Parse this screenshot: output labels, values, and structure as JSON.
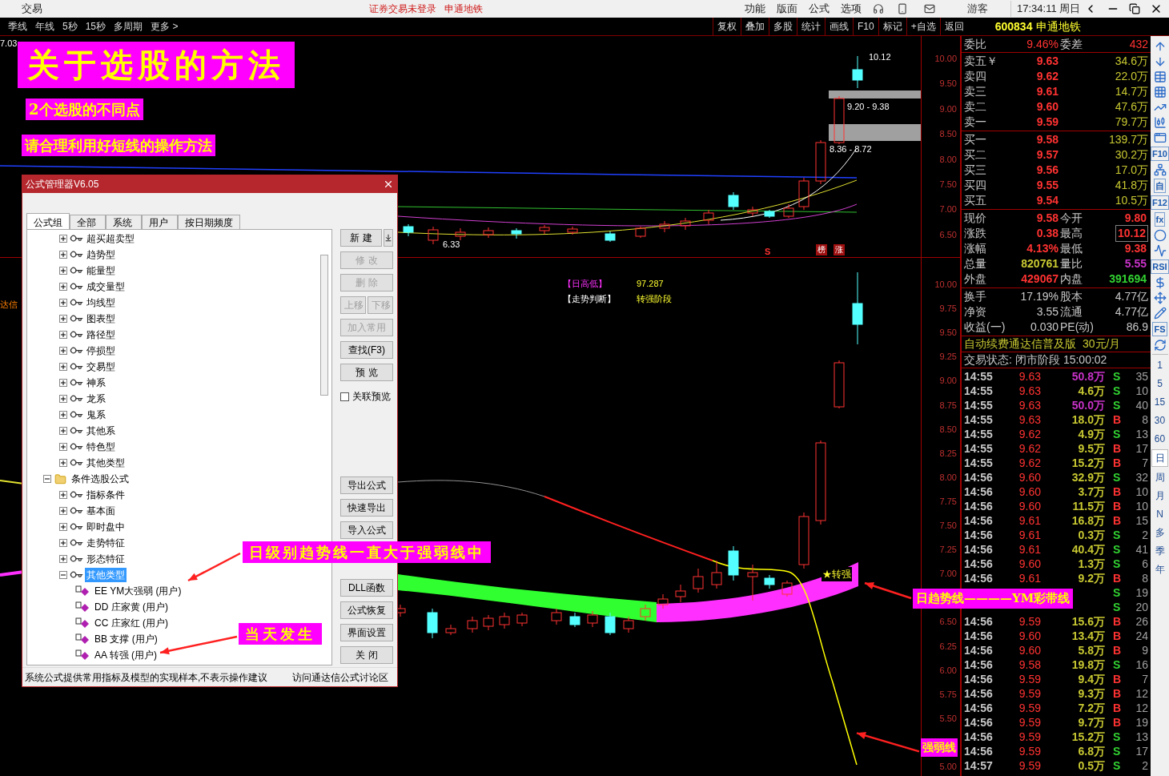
{
  "titlebar": {
    "app_label": "交易",
    "login_status": "证券交易未登录",
    "stock_name": "申通地铁",
    "menu": [
      "功能",
      "版面",
      "公式",
      "选项"
    ],
    "user": "游客",
    "clock": "17:34:11 周日"
  },
  "period_bar": [
    "季线",
    "年线",
    "5秒",
    "15秒",
    "多周期",
    "更多 >"
  ],
  "chart_toolbar": [
    "复权",
    "叠加",
    "多股",
    "统计",
    "画线",
    "F10",
    "标记",
    "+自选",
    "返回"
  ],
  "chart": {
    "corner_value": "7.03",
    "left_cut_text": "达信",
    "upper_axis": [
      "10.00",
      "9.50",
      "9.00",
      "8.50",
      "8.00",
      "7.50",
      "7.00",
      "6.50"
    ],
    "lower_axis": [
      "10.00",
      "9.75",
      "9.50",
      "9.25",
      "9.00",
      "8.75",
      "8.50",
      "8.25",
      "8.00",
      "7.75",
      "7.50",
      "7.25",
      "7.00",
      "6.50",
      "6.25",
      "6.00",
      "5.75",
      "5.50",
      "5.00"
    ],
    "high_label": "10.12",
    "zone_upper": "9.20 - 9.38",
    "zone_lower": "8.36 - 8.72",
    "low_label": "6.33",
    "signal_s": "S",
    "badges": [
      "榜",
      "涨"
    ],
    "info": [
      {
        "label": "【日高低】",
        "value": "97.287",
        "kind": "magenta"
      },
      {
        "label": "【走势判断】",
        "value": "转强阶段",
        "kind": "white"
      }
    ],
    "star_label": "★转强"
  },
  "annotations": {
    "title": "关于选股的方法",
    "subtitle": "2个选股的不同点",
    "hint": "请合理利用好短线的操作方法",
    "trend_note": "日级别趋势线一直大于强弱线中",
    "same_day": "当天发生",
    "band_note": "日趋势线————YM彩带线",
    "weak_line": "强弱线"
  },
  "dialog": {
    "title": "公式管理器V6.05",
    "tabs": [
      {
        "label": "公式组",
        "selected": true
      },
      {
        "label": "全部",
        "selected": false
      },
      {
        "label": "系统",
        "selected": false
      },
      {
        "label": "用户",
        "selected": false
      },
      {
        "label": "按日期频度",
        "selected": false
      }
    ],
    "tree": {
      "continued": [
        {
          "label": "超买超卖型",
          "kind": "group",
          "expanded": false,
          "selected": false
        },
        {
          "label": "趋势型",
          "kind": "group",
          "expanded": false,
          "selected": false
        },
        {
          "label": "能量型",
          "kind": "group",
          "expanded": false,
          "selected": false
        },
        {
          "label": "成交量型",
          "kind": "group",
          "expanded": false,
          "selected": false
        },
        {
          "label": "均线型",
          "kind": "group",
          "expanded": false,
          "selected": false
        },
        {
          "label": "图表型",
          "kind": "group",
          "expanded": false,
          "selected": false
        },
        {
          "label": "路径型",
          "kind": "group",
          "expanded": false,
          "selected": false
        },
        {
          "label": "停损型",
          "kind": "group",
          "expanded": false,
          "selected": false
        },
        {
          "label": "交易型",
          "kind": "group",
          "expanded": false,
          "selected": false
        },
        {
          "label": "神系",
          "kind": "group",
          "expanded": false,
          "selected": false
        },
        {
          "label": "龙系",
          "kind": "group",
          "expanded": false,
          "selected": false
        },
        {
          "label": "鬼系",
          "kind": "group",
          "expanded": false,
          "selected": false
        },
        {
          "label": "其他系",
          "kind": "group",
          "expanded": false,
          "selected": false
        },
        {
          "label": "特色型",
          "kind": "group",
          "expanded": false,
          "selected": false
        },
        {
          "label": "其他类型",
          "kind": "group",
          "expanded": false,
          "selected": false
        }
      ],
      "roots": [
        {
          "label": "条件选股公式",
          "kind": "folder",
          "expanded": true,
          "selected": false,
          "children": [
            {
              "label": "指标条件",
              "kind": "group",
              "expanded": false,
              "selected": false
            },
            {
              "label": "基本面",
              "kind": "group",
              "expanded": false,
              "selected": false
            },
            {
              "label": "即时盘中",
              "kind": "group",
              "expanded": false,
              "selected": false
            },
            {
              "label": "走势特征",
              "kind": "group",
              "expanded": false,
              "selected": false
            },
            {
              "label": "形态特征",
              "kind": "group",
              "expanded": false,
              "selected": false
            },
            {
              "label": "其他类型",
              "kind": "group",
              "expanded": true,
              "selected": true,
              "children": [
                {
                  "label": "EE YM大强弱 (用户)",
                  "kind": "formula",
                  "selected": false
                },
                {
                  "label": "DD 庄家黄 (用户)",
                  "kind": "formula",
                  "selected": false
                },
                {
                  "label": "CC 庄家红 (用户)",
                  "kind": "formula",
                  "selected": false
                },
                {
                  "label": "BB 支撑 (用户)",
                  "kind": "formula",
                  "selected": false
                },
                {
                  "label": "AA 转强 (用户)",
                  "kind": "formula",
                  "selected": false
                }
              ]
            }
          ]
        }
      ]
    },
    "buttons_top": [
      {
        "kind": "split",
        "label": "新 建",
        "disabled": false
      },
      {
        "kind": "button",
        "label": "修 改",
        "disabled": true
      },
      {
        "kind": "button",
        "label": "删 除",
        "disabled": true
      },
      {
        "kind": "pair",
        "items": [
          {
            "label": "上移",
            "disabled": true
          },
          {
            "label": "下移",
            "disabled": true
          }
        ]
      },
      {
        "kind": "button",
        "label": "加入常用",
        "disabled": true
      },
      {
        "kind": "button",
        "label": "查找(F3)",
        "disabled": false
      },
      {
        "kind": "button",
        "label": "预 览",
        "disabled": false
      },
      {
        "kind": "checkbox",
        "label": "关联预览",
        "checked": false
      }
    ],
    "buttons_bottom": [
      {
        "kind": "button",
        "label": "导出公式",
        "disabled": false
      },
      {
        "kind": "button",
        "label": "快速导出",
        "disabled": false
      },
      {
        "kind": "button",
        "label": "导入公式",
        "disabled": false
      },
      {
        "kind": "covered"
      },
      {
        "kind": "gap"
      },
      {
        "kind": "button",
        "label": "DLL函数",
        "disabled": false
      },
      {
        "kind": "button",
        "label": "公式恢复",
        "disabled": false
      },
      {
        "kind": "button",
        "label": "界面设置",
        "disabled": false
      },
      {
        "kind": "button",
        "label": "关 闭",
        "disabled": false
      }
    ],
    "status_text": "系统公式提供常用指标及模型的实现样本,不表示操作建议",
    "forum_link": "访问通达信公式讨论区"
  },
  "quote": {
    "code": "600834",
    "name": "申通地铁",
    "ratio": {
      "label": "委比",
      "value": "9.46%",
      "label2": "委差",
      "value2": "432"
    },
    "asks": [
      {
        "label": "卖五￥",
        "price": "9.63",
        "volume": "34.6万"
      },
      {
        "label": "卖四",
        "price": "9.62",
        "volume": "22.0万"
      },
      {
        "label": "卖三",
        "price": "9.61",
        "volume": "14.7万"
      },
      {
        "label": "卖二",
        "price": "9.60",
        "volume": "47.6万"
      },
      {
        "label": "卖一",
        "price": "9.59",
        "volume": "79.7万"
      }
    ],
    "bids": [
      {
        "label": "买一",
        "price": "9.58",
        "volume": "139.7万"
      },
      {
        "label": "买二",
        "price": "9.57",
        "volume": "30.2万"
      },
      {
        "label": "买三",
        "price": "9.56",
        "volume": "17.0万"
      },
      {
        "label": "买四",
        "price": "9.55",
        "volume": "41.8万"
      },
      {
        "label": "买五",
        "price": "9.54",
        "volume": "10.5万"
      }
    ],
    "stats": [
      {
        "left": {
          "label": "现价",
          "value": "9.58",
          "color": "#ff3232",
          "boxed": false
        },
        "right": {
          "label": "今开",
          "value": "9.80",
          "color": "#ff3232",
          "boxed": false
        }
      },
      {
        "left": {
          "label": "涨跌",
          "value": "0.38",
          "color": "#ff3232",
          "boxed": false
        },
        "right": {
          "label": "最高",
          "value": "10.12",
          "color": "#ff3232",
          "boxed": true
        }
      },
      {
        "left": {
          "label": "涨幅",
          "value": "4.13%",
          "color": "#ff3232",
          "boxed": false
        },
        "right": {
          "label": "最低",
          "value": "9.38",
          "color": "#ff3232",
          "boxed": false
        }
      },
      {
        "left": {
          "label": "总量",
          "value": "820761",
          "color": "#c8c832",
          "boxed": false
        },
        "right": {
          "label": "量比",
          "value": "5.55",
          "color": "#c832c8",
          "boxed": false
        }
      },
      {
        "left": {
          "label": "外盘",
          "value": "429067",
          "color": "#ff3232",
          "boxed": false
        },
        "right": {
          "label": "内盘",
          "value": "391694",
          "color": "#32d232",
          "boxed": false
        }
      }
    ],
    "fundamentals": [
      {
        "label": "换手",
        "value": "17.19%",
        "label2": "股本",
        "value2": "4.77亿"
      },
      {
        "label": "净资",
        "value": "3.55",
        "label2": "流通",
        "value2": "4.77亿"
      },
      {
        "label": "收益(一)",
        "value": "0.030",
        "label2": "PE(动)",
        "value2": "86.9"
      }
    ],
    "promo": "自动续费通达信普及版",
    "promo_price": "30元/月",
    "trade_state_label": "交易状态:",
    "trade_state": "闭市阶段",
    "trade_time": "15:00:02",
    "ticks": [
      {
        "time": "14:55",
        "price": "9.63",
        "volume": "50.8万",
        "color": "#c832c8",
        "side": "S",
        "kind": "sell",
        "count": "35"
      },
      {
        "time": "14:55",
        "price": "9.63",
        "volume": "4.6万",
        "color": "#c8c832",
        "side": "S",
        "kind": "sell",
        "count": "10"
      },
      {
        "time": "14:55",
        "price": "9.63",
        "volume": "50.0万",
        "color": "#c832c8",
        "side": "S",
        "kind": "sell",
        "count": "40"
      },
      {
        "time": "14:55",
        "price": "9.63",
        "volume": "18.0万",
        "color": "#c8c832",
        "side": "B",
        "kind": "buy",
        "count": "8"
      },
      {
        "time": "14:55",
        "price": "9.62",
        "volume": "4.9万",
        "color": "#c8c832",
        "side": "S",
        "kind": "sell",
        "count": "13"
      },
      {
        "time": "14:55",
        "price": "9.62",
        "volume": "9.5万",
        "color": "#c8c832",
        "side": "B",
        "kind": "buy",
        "count": "17"
      },
      {
        "time": "14:55",
        "price": "9.62",
        "volume": "15.2万",
        "color": "#c8c832",
        "side": "B",
        "kind": "buy",
        "count": "7"
      },
      {
        "time": "14:56",
        "price": "9.60",
        "volume": "32.9万",
        "color": "#c8c832",
        "side": "S",
        "kind": "sell",
        "count": "32"
      },
      {
        "time": "14:56",
        "price": "9.60",
        "volume": "3.7万",
        "color": "#c8c832",
        "side": "B",
        "kind": "buy",
        "count": "10"
      },
      {
        "time": "14:56",
        "price": "9.60",
        "volume": "11.5万",
        "color": "#c8c832",
        "side": "B",
        "kind": "buy",
        "count": "10"
      },
      {
        "time": "14:56",
        "price": "9.61",
        "volume": "16.8万",
        "color": "#c8c832",
        "side": "B",
        "kind": "buy",
        "count": "15"
      },
      {
        "time": "14:56",
        "price": "9.61",
        "volume": "0.3万",
        "color": "#c8c832",
        "side": "S",
        "kind": "sell",
        "count": "2"
      },
      {
        "time": "14:56",
        "price": "9.61",
        "volume": "40.4万",
        "color": "#c8c832",
        "side": "S",
        "kind": "sell",
        "count": "41"
      },
      {
        "time": "14:56",
        "price": "9.60",
        "volume": "1.3万",
        "color": "#c8c832",
        "side": "S",
        "kind": "sell",
        "count": "6"
      },
      {
        "time": "14:56",
        "price": "9.61",
        "volume": "9.2万",
        "color": "#c8c832",
        "side": "B",
        "kind": "buy",
        "count": "8"
      },
      {
        "side": "S",
        "kind": "sell",
        "count": "19"
      },
      {
        "side": "S",
        "kind": "sell",
        "count": "20"
      },
      {
        "time": "14:56",
        "price": "9.59",
        "volume": "15.6万",
        "color": "#c8c832",
        "side": "B",
        "kind": "buy",
        "count": "26"
      },
      {
        "time": "14:56",
        "price": "9.60",
        "volume": "13.4万",
        "color": "#c8c832",
        "side": "B",
        "kind": "buy",
        "count": "24"
      },
      {
        "time": "14:56",
        "price": "9.60",
        "volume": "5.8万",
        "color": "#c8c832",
        "side": "B",
        "kind": "buy",
        "count": "9"
      },
      {
        "time": "14:56",
        "price": "9.58",
        "volume": "19.8万",
        "color": "#c8c832",
        "side": "S",
        "kind": "sell",
        "count": "16"
      },
      {
        "time": "14:56",
        "price": "9.59",
        "volume": "9.4万",
        "color": "#c8c832",
        "side": "B",
        "kind": "buy",
        "count": "7"
      },
      {
        "time": "14:56",
        "price": "9.59",
        "volume": "9.3万",
        "color": "#c8c832",
        "side": "B",
        "kind": "buy",
        "count": "12"
      },
      {
        "time": "14:56",
        "price": "9.59",
        "volume": "7.2万",
        "color": "#c8c832",
        "side": "B",
        "kind": "buy",
        "count": "12"
      },
      {
        "time": "14:56",
        "price": "9.59",
        "volume": "9.7万",
        "color": "#c8c832",
        "side": "B",
        "kind": "buy",
        "count": "19"
      },
      {
        "time": "14:56",
        "price": "9.59",
        "volume": "15.2万",
        "color": "#c8c832",
        "side": "S",
        "kind": "sell",
        "count": "13"
      },
      {
        "time": "14:56",
        "price": "9.59",
        "volume": "6.8万",
        "color": "#c8c832",
        "side": "S",
        "kind": "sell",
        "count": "17"
      },
      {
        "time": "14:57",
        "price": "9.59",
        "volume": "0.5万",
        "color": "#c8c832",
        "side": "S",
        "kind": "sell",
        "count": "2"
      }
    ]
  },
  "side_tools": [
    {
      "kind": "up"
    },
    {
      "kind": "down"
    },
    {
      "kind": "table"
    },
    {
      "kind": "grid"
    },
    {
      "kind": "line"
    },
    {
      "kind": "candles"
    },
    {
      "kind": "windows"
    },
    {
      "kind": "text",
      "label": "F10"
    },
    {
      "kind": "tree"
    },
    {
      "kind": "text",
      "label": "自"
    },
    {
      "kind": "text",
      "label": "F12"
    },
    {
      "kind": "text",
      "label": "fx"
    },
    {
      "kind": "circle"
    },
    {
      "kind": "wave"
    },
    {
      "kind": "text",
      "label": "RSI"
    },
    {
      "kind": "dollar"
    },
    {
      "kind": "move"
    },
    {
      "kind": "pencil"
    },
    {
      "kind": "text",
      "label": "FS"
    },
    {
      "kind": "refresh"
    }
  ],
  "periods": [
    {
      "label": "1",
      "selected": false
    },
    {
      "label": "5",
      "selected": false
    },
    {
      "label": "15",
      "selected": false
    },
    {
      "label": "30",
      "selected": false
    },
    {
      "label": "60",
      "selected": false
    },
    {
      "label": "日",
      "selected": true
    },
    {
      "label": "周",
      "selected": false
    },
    {
      "label": "月",
      "selected": false
    },
    {
      "label": "N",
      "selected": false
    },
    {
      "label": "多",
      "selected": false
    },
    {
      "label": "季",
      "selected": false
    },
    {
      "label": "年",
      "selected": false
    }
  ]
}
